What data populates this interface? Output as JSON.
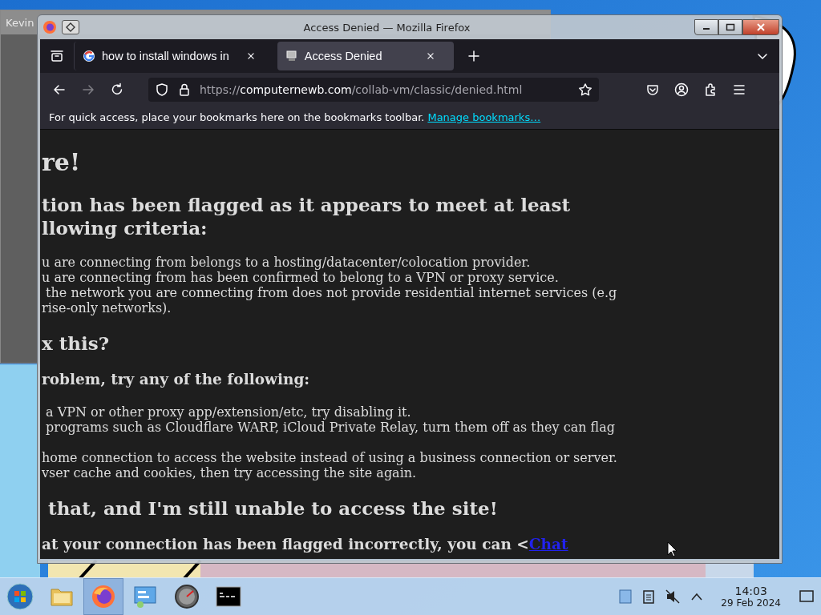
{
  "background_window": {
    "title": "Kevin"
  },
  "window": {
    "title": "Access Denied — Mozilla Firefox"
  },
  "tabs": [
    {
      "label": "how to install windows in",
      "selected": false
    },
    {
      "label": "Access Denied",
      "selected": true
    }
  ],
  "address_bar": {
    "scheme": "https://",
    "host": "computernewb.com",
    "path": "/collab-vm/classic/denied.html"
  },
  "nav": {
    "forward_disabled": true
  },
  "bookmarks_bar": {
    "message": "For quick access, place your bookmarks here on the bookmarks toolbar.",
    "link": "Manage bookmarks…"
  },
  "page": [
    {
      "kind": "h1",
      "lines": [
        "re!"
      ]
    },
    {
      "kind": "h2",
      "lines": [
        "tion has been flagged as it appears to meet at least",
        "llowing criteria:"
      ]
    },
    {
      "kind": "p",
      "lines": [
        "u are connecting from belongs to a hosting/datacenter/colocation provider.",
        "u are connecting from has been confirmed to belong to a VPN or proxy service.",
        " the network you are connecting from does not provide residential internet services (e.g",
        "rise-only networks)."
      ]
    },
    {
      "kind": "h2",
      "lines": [
        "x this?"
      ]
    },
    {
      "kind": "h3",
      "lines": [
        "roblem, try any of the following:"
      ]
    },
    {
      "kind": "p",
      "lines": [
        " a VPN or other proxy app/extension/etc, try disabling it.",
        " programs such as Cloudflare WARP, iCloud Private Relay, turn them off as they can flag"
      ]
    },
    {
      "kind": "p",
      "lines": [
        "home connection to access the website instead of using a business connection or server.",
        "vser cache and cookies, then try accessing the site again."
      ]
    },
    {
      "kind": "h2",
      "lines": [
        " that, and I'm still unable to access the site!"
      ]
    },
    {
      "kind": "h3",
      "lines": [
        "at your connection has been flagged incorrectly, you can <"
      ],
      "link": "Chat"
    }
  ],
  "taskbar": {
    "apps": [
      {
        "kind": "folder",
        "selected": false
      },
      {
        "kind": "firefox",
        "selected": true
      },
      {
        "kind": "control-panel",
        "selected": false
      },
      {
        "kind": "gauge",
        "selected": false
      },
      {
        "kind": "terminal",
        "selected": false
      }
    ],
    "time": "14:03",
    "date": "29 Feb 2024"
  }
}
